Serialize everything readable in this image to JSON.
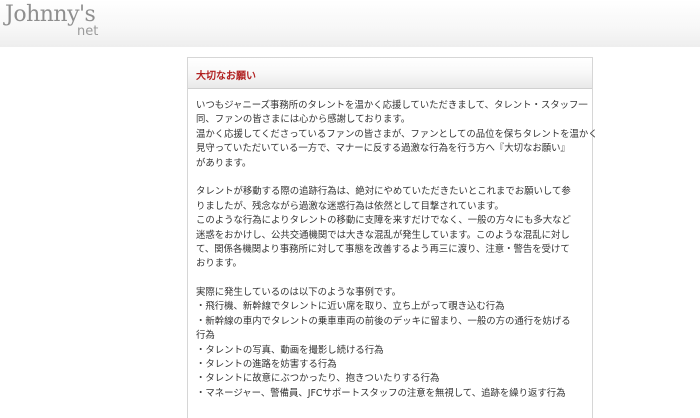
{
  "header": {
    "logo_main": "Johnny's",
    "logo_sub": "net"
  },
  "notice": {
    "title": "大切なお願い",
    "para1": [
      "いつもジャニーズ事務所のタレントを温かく応援していただきまして、タレント・スタッフ一",
      "同、ファンの皆さまには心から感謝しております。",
      "温かく応援してくださっているファンの皆さまが、ファンとしての品位を保ちタレントを温かく",
      "見守っていただいている一方で、マナーに反する過激な行為を行う方へ『大切なお願い』",
      "があります。"
    ],
    "para2": [
      "タレントが移動する際の追跡行為は、絶対にやめていただきたいとこれまでお願いして参",
      "りましたが、残念ながら過激な迷惑行為は依然として目撃されています。",
      "このような行為によりタレントの移動に支障を来すだけでなく、一般の方々にも多大など",
      "迷惑をおかけし、公共交通機関では大きな混乱が発生しています。このような混乱に対し",
      "て、関係各機関より事務所に対して事態を改善するよう再三に渡り、注意・警告を受けて",
      "おります。"
    ],
    "para3": [
      "実際に発生しているのは以下のような事例です。",
      "・飛行機、新幹線でタレントに近い席を取り、立ち上がって覗き込む行為",
      "・新幹線の車内でタレントの乗車車両の前後のデッキに留まり、一般の方の通行を妨げる",
      "行為",
      "・タレントの写真、動画を撮影し続ける行為",
      "・タレントの進路を妨害する行為",
      "・タレントに故意にぶつかったり、抱きついたりする行為",
      "・マネージャー、警備員、JFCサポートスタッフの注意を無視して、追跡を繰り返す行為"
    ]
  }
}
